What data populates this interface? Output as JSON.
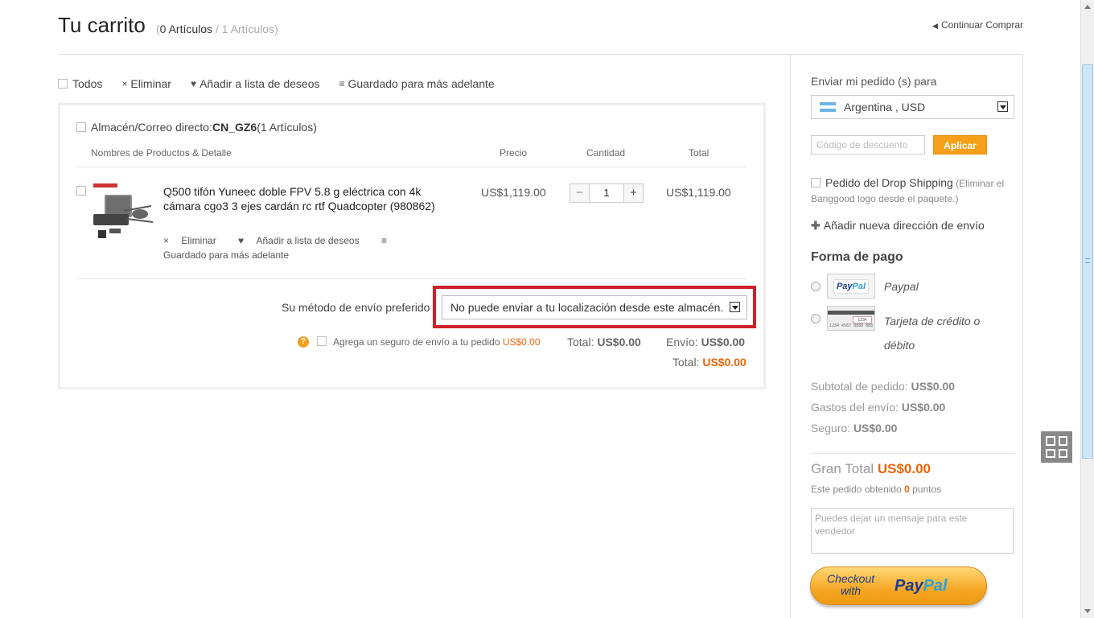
{
  "header": {
    "title": "Tu carrito",
    "paren_open": "(",
    "current_count": "0 Artículos",
    "separator": " / ",
    "total_count": "1 Artículos)",
    "continue_label": "Continuar Comprar"
  },
  "toolbar": {
    "select_all": "Todos",
    "delete": "Eliminar",
    "wishlist": "Añadir a lista de deseos",
    "save_later": "Guardado para más adelante"
  },
  "warehouse": {
    "label": "Almacén/Correo directo: ",
    "code": "CN_GZ6",
    "count": " (1 Artículos)"
  },
  "columns": {
    "name": "Nombres de Productos & Detalle",
    "price": "Precio",
    "qty": "Cantidad",
    "total": "Total"
  },
  "product": {
    "name": "Q500 tifón Yuneec doble FPV 5.8 g eléctrica con 4k cámara cgo3 3 ejes cardán rc rtf Quadcopter (980862)",
    "price": "US$1,119.00",
    "quantity": "1",
    "total": "US$1,119.00",
    "delete": "Eliminar",
    "wishlist": "Añadir a lista de deseos",
    "save_later": "Guardado para más adelante"
  },
  "shipping": {
    "label": "Su método de envío preferido",
    "selected": "No puede enviar a tu localización desde este almacén.",
    "insurance_label": "Agrega un seguro de envío a tu pedido ",
    "insurance_price": "US$0.00",
    "total_label": "Total: ",
    "total_value": "US$0.00",
    "shipping_label": "Envío: ",
    "shipping_value": "US$0.00",
    "grand_label": "Total: ",
    "grand_value": "US$0.00"
  },
  "sidebar": {
    "ship_to_label": "Enviar mi pedido (s) para",
    "country": "Argentina , USD",
    "coupon_placeholder": "Código de descuento",
    "apply_label": "Aplicar",
    "dropship_label": "Pedido del Drop Shipping",
    "dropship_note": " (Eliminar el Banggood logo desde el paquete.)",
    "new_address": "Añadir nueva dirección de envío",
    "payment_title": "Forma de pago",
    "paypal_label": "Paypal",
    "card_label": "Tarjeta de crédito o débito",
    "subtotal_label": "Subtotal de pedido: ",
    "subtotal_value": "US$0.00",
    "shipping_cost_label": "Gastos del envío: ",
    "shipping_cost_value": "US$0.00",
    "insurance_label": "Seguro: ",
    "insurance_value": "US$0.00",
    "grand_total_label": "Gran Total ",
    "grand_total_value": "US$0.00",
    "points_prefix": "Este pedido obtenido ",
    "points_value": "0",
    "points_suffix": " puntos",
    "message_placeholder": "Puedes dejar un mensaje para este vendedor",
    "checkout_text_1": "Checkout",
    "checkout_text_2": "with",
    "checkout_brand_1": "Pay",
    "checkout_brand_2": "Pal"
  },
  "colors": {
    "accent_orange": "#e8650c",
    "apply_button": "#f6a01a",
    "highlight_red": "#d0202a"
  }
}
